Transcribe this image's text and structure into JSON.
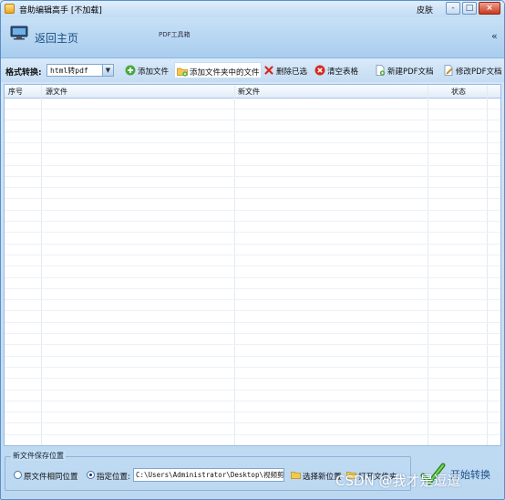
{
  "window": {
    "title": "音助编辑高手 [不加载]",
    "skin_label": "皮肤",
    "minimize": "-",
    "maximize": "□",
    "close": "×"
  },
  "header": {
    "home_label": "返回主页",
    "toolbox_label": "PDF工具箱",
    "collapse_label": "«"
  },
  "toolbar": {
    "format_label": "格式转换:",
    "format_value": "html转pdf",
    "add_file": "添加文件",
    "add_folder_files": "添加文件夹中的文件",
    "delete_selected": "删除已选",
    "clear_table": "清空表格",
    "new_pdf": "新建PDF文档",
    "edit_pdf": "修改PDF文档"
  },
  "table": {
    "columns": [
      "序号",
      "源文件",
      "新文件",
      "状态"
    ],
    "rows": []
  },
  "save_location": {
    "legend": "新文件保存位置",
    "option_same": "原文件相同位置",
    "option_custom": "指定位置:",
    "selected": "option_custom",
    "path": "C:\\Users\\Administrator\\Desktop\\视频剪辑\\音",
    "choose_new": "选择新位置",
    "open_folder": "打开文件夹"
  },
  "start_button": "开始转换",
  "watermark": "CSDN @我才是逗逗"
}
